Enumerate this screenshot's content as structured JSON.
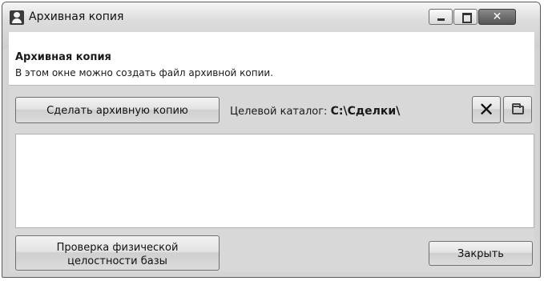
{
  "window": {
    "title": "Архивная копия",
    "close_symbol": "✕"
  },
  "header": {
    "title": "Архивная копия",
    "description": "В этом окне можно создать файл архивной копии."
  },
  "toolbar": {
    "backup_button_label": "Сделать архивную копию",
    "target_dir_label": "Целевой каталог:",
    "target_dir_value": "C:\\Сделки\\",
    "clear_button_symbol": "✕",
    "clear_icon": "close-icon",
    "browse_icon": "folder-icon"
  },
  "log": {
    "content": ""
  },
  "footer": {
    "integrity_button_line1": "Проверка физической",
    "integrity_button_line2": "целостности базы",
    "close_button_label": "Закрыть"
  }
}
